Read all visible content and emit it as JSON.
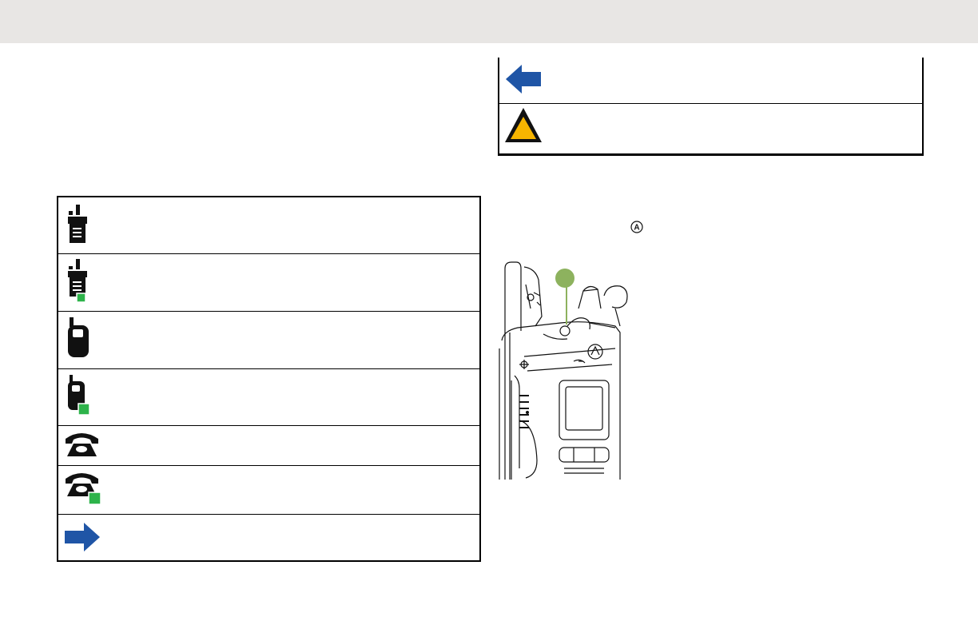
{
  "header": {
    "background": "#e8e6e4"
  },
  "icon_table": {
    "rows": [
      {
        "icon": "radio-icon"
      },
      {
        "icon": "radio-sent-icon"
      },
      {
        "icon": "mobile-phone-icon"
      },
      {
        "icon": "mobile-phone-sent-icon"
      },
      {
        "icon": "telephone-icon"
      },
      {
        "icon": "telephone-sent-icon"
      },
      {
        "icon": "right-arrow-icon"
      }
    ]
  },
  "note_table": {
    "rows": [
      {
        "icon": "left-arrow-icon"
      },
      {
        "icon": "warning-triangle-icon"
      }
    ]
  },
  "callout_letter": "A",
  "colors": {
    "arrow_blue": "#1f55a6",
    "status_green": "#2db34a",
    "warning_yellow": "#f7b500",
    "callout_green": "#8db25e"
  }
}
